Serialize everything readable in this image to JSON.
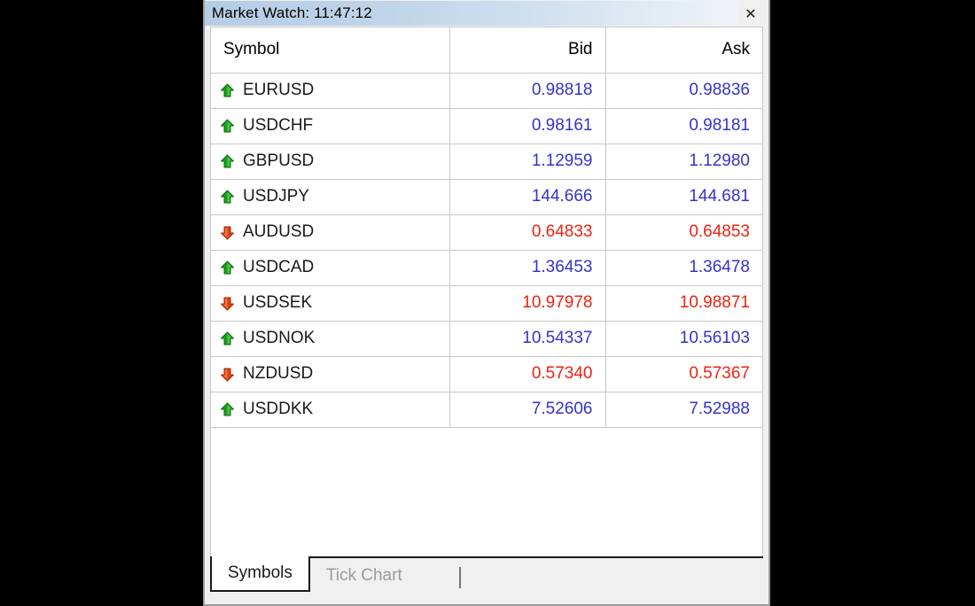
{
  "window": {
    "title": "Market Watch: 11:47:12",
    "close_label": "✕",
    "close_icon": "close-icon"
  },
  "table": {
    "columns": [
      "Symbol",
      "Bid",
      "Ask"
    ],
    "rows": [
      {
        "symbol": "EURUSD",
        "direction": "up",
        "bid": "0.98818",
        "ask": "0.98836"
      },
      {
        "symbol": "USDCHF",
        "direction": "up",
        "bid": "0.98161",
        "ask": "0.98181"
      },
      {
        "symbol": "GBPUSD",
        "direction": "up",
        "bid": "1.12959",
        "ask": "1.12980"
      },
      {
        "symbol": "USDJPY",
        "direction": "up",
        "bid": "144.666",
        "ask": "144.681"
      },
      {
        "symbol": "AUDUSD",
        "direction": "down",
        "bid": "0.64833",
        "ask": "0.64853"
      },
      {
        "symbol": "USDCAD",
        "direction": "up",
        "bid": "1.36453",
        "ask": "1.36478"
      },
      {
        "symbol": "USDSEK",
        "direction": "down",
        "bid": "10.97978",
        "ask": "10.98871"
      },
      {
        "symbol": "USDNOK",
        "direction": "up",
        "bid": "10.54337",
        "ask": "10.56103"
      },
      {
        "symbol": "NZDUSD",
        "direction": "down",
        "bid": "0.57340",
        "ask": "0.57367"
      },
      {
        "symbol": "USDDKK",
        "direction": "up",
        "bid": "7.52606",
        "ask": "7.52988"
      }
    ]
  },
  "tabs": [
    {
      "label": "Symbols",
      "active": true
    },
    {
      "label": "Tick Chart",
      "active": false
    }
  ],
  "colors": {
    "price_up": "#3333cc",
    "price_down": "#ee2211",
    "arrow_up": "#18a018",
    "arrow_down": "#e04010",
    "title_gradient_start": "#b5cde5",
    "title_gradient_end": "#eef3f8",
    "grid_line": "#c8c8c8"
  }
}
